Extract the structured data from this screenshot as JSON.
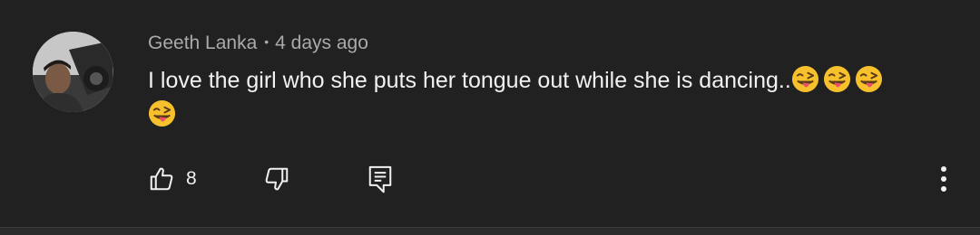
{
  "comment": {
    "author": "Geeth Lanka",
    "separator": "•",
    "time": "4 days ago",
    "text": "I love the girl who she puts her tongue out while she is dancing..",
    "emojis": [
      "winking-tongue-emoji",
      "winking-tongue-emoji",
      "winking-tongue-emoji",
      "winking-tongue-emoji"
    ]
  },
  "actions": {
    "like_count": "8",
    "like_icon": "thumbs-up-icon",
    "dislike_icon": "thumbs-down-icon",
    "reply_icon": "reply-icon",
    "more_icon": "more-vertical-icon"
  },
  "colors": {
    "background": "#212121",
    "meta_text": "#aaaaaa",
    "body_text": "#f1f1f1"
  }
}
